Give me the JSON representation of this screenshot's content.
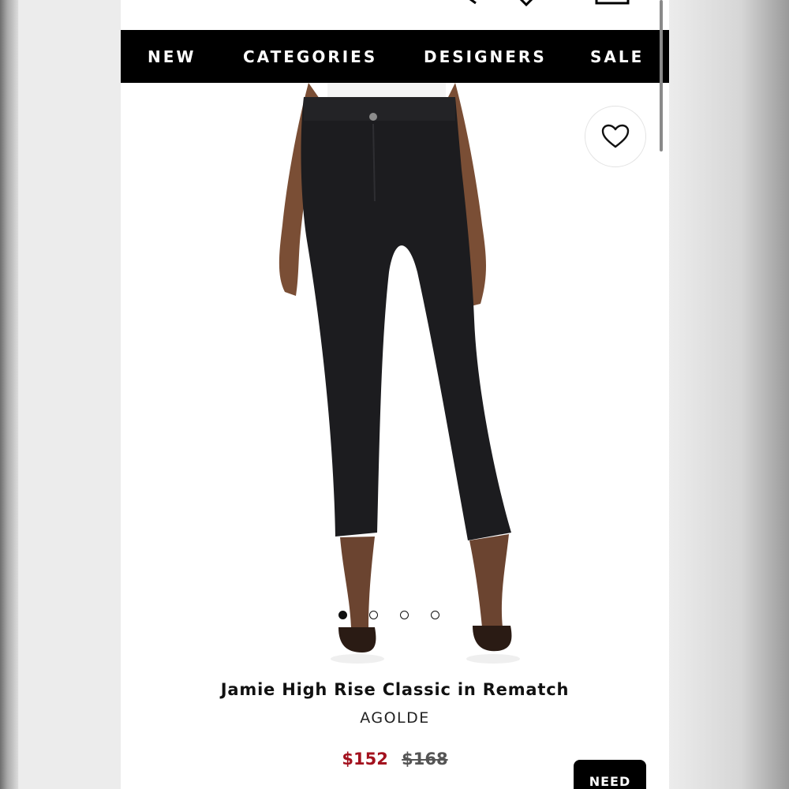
{
  "nav": {
    "items": [
      {
        "label": "NEW"
      },
      {
        "label": "CATEGORIES"
      },
      {
        "label": "DESIGNERS"
      },
      {
        "label": "SALE"
      }
    ]
  },
  "product": {
    "title": "Jamie High Rise Classic in Rematch",
    "designer": "AGOLDE",
    "sale_price": "$152",
    "original_price": "$168",
    "image_carousel": {
      "count": 4,
      "active_index": 0
    }
  },
  "actions": {
    "need_button_label": "NEED"
  },
  "icons": [
    "search-icon",
    "heart-icon",
    "bag-icon",
    "wishlist-heart-icon"
  ],
  "colors": {
    "nav_background": "#000000",
    "sale_price": "#a3111e"
  }
}
